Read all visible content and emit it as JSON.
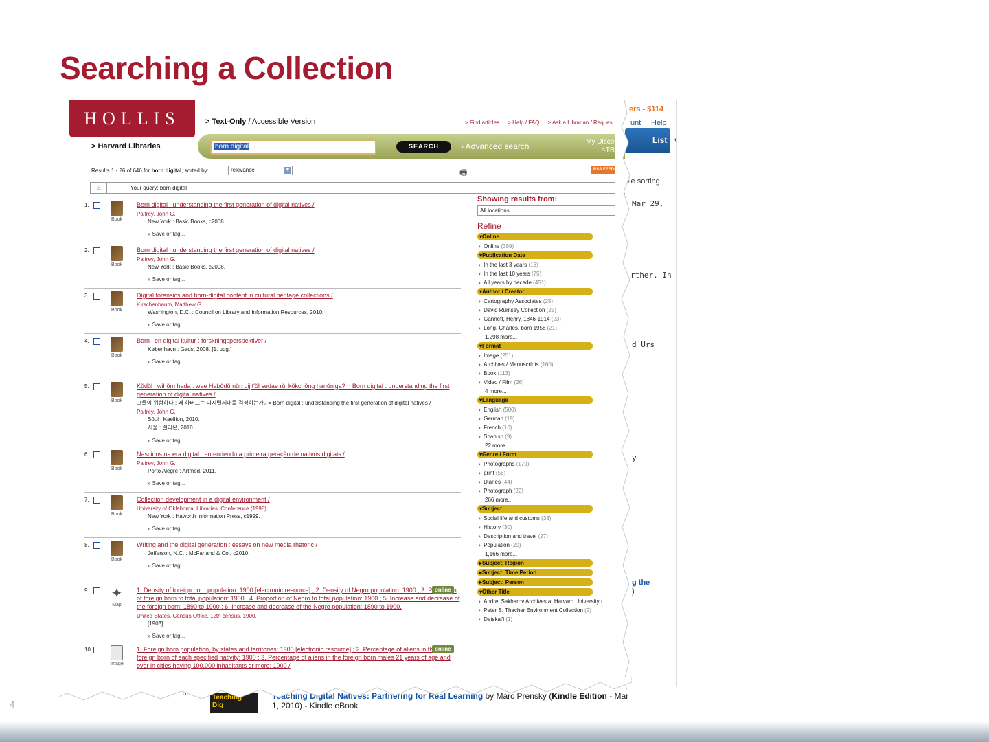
{
  "slide": {
    "title": "Searching a Collection",
    "number": "4"
  },
  "hollis": {
    "logo": "HOLLIS",
    "text_only": "> Text-Only",
    "accessible": " / Accessible Version",
    "top_links": [
      "> Find articles",
      "> Help / FAQ",
      "> Ask a Librarian / Reques"
    ],
    "harvard_libraries": "> Harvard Libraries",
    "search_value": "born digital",
    "search_button": "SEARCH",
    "advanced_search": "› Advanced search",
    "my_discoverie": "My Discoverie",
    "trial": "<TRIAL>",
    "results_prefix": "Results 1 - 26 of 646 for ",
    "results_query": "born digital",
    "results_suffix": ", sorted by:",
    "sort_value": "relevance",
    "print_icon": "🖶",
    "rss": "RSS FEEDS",
    "home_icon": "⌂",
    "your_query": "Your query: born digital"
  },
  "results": [
    {
      "num": "1.",
      "format": "Book",
      "title": "Born digital : understanding the first generation of digital natives /",
      "author": "Palfrey, John G.",
      "pub": "New York : Basic Books, c2008.",
      "save": "» Save or tag..."
    },
    {
      "num": "2.",
      "format": "Book",
      "title": "Born digital : understanding the first generation of digital natives /",
      "author": "Palfrey, John G.",
      "pub": "New York : Basic Books, c2008.",
      "save": "» Save or tag..."
    },
    {
      "num": "3.",
      "format": "Book",
      "title": "Digital forensics and born-digital content in cultural heritage collections /",
      "author": "Kirschenbaum, Matthew G.",
      "pub": "Washington, D.C. : Council on Library and Information Resources, 2010.",
      "save": "» Save or tag..."
    },
    {
      "num": "4.",
      "format": "Book",
      "title": "Born i en digital kultur : forskningsperspektiver /",
      "pub": "København : Gads, 2008. [1. udg.]",
      "save": "» Save or tag..."
    },
    {
      "num": "5.",
      "format": "Book",
      "title": "Kŭdŭl i wihŏm hada : wae Habŏdŭ nŭn dijit'ŏl sedae rŭl kŏkchŏng hanŭn'ga? = Born digital : understanding the first generation of digital natives /",
      "alt": "그들이 위험하다 : 왜 하버드는 디지털세대를 걱정하는가? = Born digital : understanding the first generation of digital natives /",
      "author": "Palfrey, John G.",
      "pub": "Sŏul : Kaellion, 2010.",
      "pub2": "서울 : 갤리온, 2010.",
      "save": "» Save or tag..."
    },
    {
      "num": "6.",
      "format": "Book",
      "title": "Nascidos na era digital : entendendo a primeira geração de nativos digitais /",
      "author": "Palfrey, John G.",
      "pub": "Porto Alegre : Artmed, 2011.",
      "save": "» Save or tag..."
    },
    {
      "num": "7.",
      "format": "Book",
      "title": "Collection development in a digital environment /",
      "author": "University of Oklahoma. Libraries. Conference (1998)",
      "pub": "New York : Haworth Information Press, c1999.",
      "save": "» Save or tag..."
    },
    {
      "num": "8.",
      "format": "Book",
      "title": "Writing and the digital generation : essays on new media rhetoric /",
      "pub": "Jefferson, N.C. : McFarland & Co., c2010.",
      "save": "» Save or tag..."
    },
    {
      "num": "9.",
      "format": "Map",
      "online": "online",
      "title": "1. Density of foreign born population: 1900 [electronic resource] ; 2. Density of Negro population: 1900 ; 3. Proportion of foreign born to total population: 1900 ; 4. Proportion of Negro to total population: 1900 ; 5. Increase and decrease of the foreign born: 1890 to 1900 ; 6. Increase and decrease of the Negro population: 1890 to 1900.",
      "author": "United States. Census Office. 12th census, 1900.",
      "pub": "[1903].",
      "save": "» Save or tag..."
    },
    {
      "num": "10.",
      "format": "Image",
      "online": "online",
      "title": "1. Foreign born population, by states and territories: 1900 [electronic resource] ; 2. Percentage of aliens in the total foreign born of each specified nativity: 1900 ; 3. Percentage of aliens in the foreign born males 21 years of age and over in cities having 100,000 inhabitants or more: 1900 /"
    }
  ],
  "facets": {
    "showing_label": "Showing results from:",
    "location": "All locations",
    "refine": "Refine",
    "groups": [
      {
        "name": "Online",
        "items": [
          {
            "label": "Online",
            "count": "(389)"
          }
        ]
      },
      {
        "name": "Publication Date",
        "items": [
          {
            "label": "In the last 3 years",
            "count": "(16)"
          },
          {
            "label": "In the last 10 years",
            "count": "(75)"
          },
          {
            "label": "All years by decade",
            "count": "(451)"
          }
        ]
      },
      {
        "name": "Author / Creator",
        "items": [
          {
            "label": "Cartography Associates",
            "count": "(25)"
          },
          {
            "label": "David Rumsey Collection",
            "count": "(25)"
          },
          {
            "label": "Gannett, Henry, 1846-1914",
            "count": "(23)"
          },
          {
            "label": "Long, Charles, born 1958",
            "count": "(21)"
          }
        ],
        "more": "1,298 more..."
      },
      {
        "name": "Format",
        "items": [
          {
            "label": "Image",
            "count": "(251)"
          },
          {
            "label": "Archives / Manuscripts",
            "count": "(160)"
          },
          {
            "label": "Book",
            "count": "(113)"
          },
          {
            "label": "Video / Film",
            "count": "(26)"
          }
        ],
        "more": "4 more..."
      },
      {
        "name": "Language",
        "items": [
          {
            "label": "English",
            "count": "(500)"
          },
          {
            "label": "German",
            "count": "(19)"
          },
          {
            "label": "French",
            "count": "(16)"
          },
          {
            "label": "Spanish",
            "count": "(9)"
          }
        ],
        "more": "22 more..."
      },
      {
        "name": "Genre / Form",
        "items": [
          {
            "label": "Photographs",
            "count": "(179)"
          },
          {
            "label": "print",
            "count": "(56)"
          },
          {
            "label": "Diaries",
            "count": "(44)"
          },
          {
            "label": "Photograph",
            "count": "(22)"
          }
        ],
        "more": "266 more..."
      },
      {
        "name": "Subject",
        "items": [
          {
            "label": "Social life and customs",
            "count": "(33)"
          },
          {
            "label": "History",
            "count": "(30)"
          },
          {
            "label": "Description and travel",
            "count": "(27)"
          },
          {
            "label": "Population",
            "count": "(20)"
          }
        ],
        "more": "1,166 more..."
      },
      {
        "name": "Subject: Region",
        "collapsed": true
      },
      {
        "name": "Subject: Time Period",
        "collapsed": true
      },
      {
        "name": "Subject: Person",
        "collapsed": true
      },
      {
        "name": "Other Title",
        "items": [
          {
            "label": "Andrei Sakharov Archives at Harvard University",
            "count": "("
          },
          {
            "label": "Peter S. Thacher Environment Collection",
            "count": "(2)"
          },
          {
            "label": "Detskal'i",
            "count": "(1)"
          }
        ]
      }
    ]
  },
  "underlying": {
    "top": "ers - $114",
    "account": "unt",
    "help": "Help",
    "list_btn": "List",
    "sorting": "ble sorting",
    "mar": "Mar 29,",
    "rther": "rther. In",
    "urs": "d Urs",
    "y": "y",
    "g_the": "g the",
    "paren": ")",
    "s_label": "5.",
    "thumb": "Teaching",
    "thumb_sub": "Dig",
    "book_title": "Teaching Digital Natives: Partnering for Real Learning",
    "book_by": " by Marc Prensky (",
    "book_kindle": "Kindle Edition",
    "book_mar": " - Mar",
    "book_sub": "1, 2010) - Kindle eBook"
  }
}
